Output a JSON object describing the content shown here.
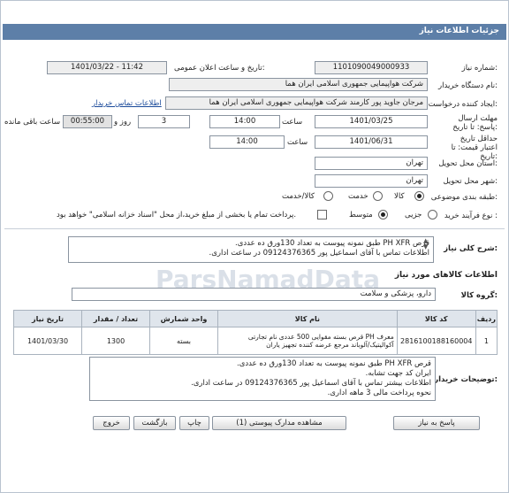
{
  "page_title": "جزئیات اطلاعات نیاز",
  "watermark": "ParsNamadData",
  "fields": {
    "need_number_label": "شماره نیاز:",
    "need_number": "1101090049000933",
    "announce_label": "تاریخ و ساعت اعلان عمومی:",
    "announce_value": "1401/03/22 - 11:42",
    "buyer_label": "نام دستگاه خریدار:",
    "buyer_value": "شرکت هواپیمایی جمهوری اسلامی ایران هما",
    "creator_label": "ایجاد کننده درخواست:",
    "creator_value": "مرجان جاوید پور کارمند شرکت هواپیمایی جمهوری اسلامی ایران هما",
    "contact_link": "اطلاعات تماس خریدار",
    "deadline_label": "مهلت ارسال پاسخ: تا تاریخ:",
    "deadline_date": "1401/03/25",
    "hour_label": "ساعت",
    "deadline_time": "14:00",
    "days": "3",
    "days_label": "روز و",
    "remaining_time": "00:55:00",
    "remaining_label": "ساعت باقی مانده",
    "validity_label": "حداقل تاریخ اعتبار قیمت: تا تاریخ:",
    "validity_date": "1401/06/31",
    "validity_hour_label": "ساعت",
    "validity_time": "14:00",
    "province_label": "استان محل تحویل:",
    "province_value": "تهران",
    "city_label": "شهر محل تحویل:",
    "city_value": "تهران",
    "category_label": "طبقه بندی موضوعی:",
    "category_options": [
      "کالا",
      "خدمت",
      "کالا/خدمت"
    ],
    "process_label": "نوع فرآیند خرید :",
    "process_options": [
      "جزیی",
      "متوسط"
    ],
    "payment_note": "پرداخت تمام یا بخشی از مبلغ خرید،از محل \"اسناد خزانه اسلامی\" خواهد بود."
  },
  "description": {
    "label": "شرح کلی نیاز:",
    "lines": [
      "قرص PH XFR طبق نمونه پیوست به تعداد 130ورق ده عددی.",
      "اطلاعات  تماس با آقای اسماعیل پور 09124376365 در ساعت اداری."
    ]
  },
  "goods_section_title": "اطلاعات کالاهای مورد نیاز",
  "goods_group_label": "گروه کالا:",
  "goods_group_value": "دارو، پزشکی و سلامت",
  "table": {
    "headers": [
      "ردیف",
      "کد کالا",
      "نام کالا",
      "واحد شمارش",
      "تعداد / مقدار",
      "تاریخ نیاز"
    ],
    "rows": [
      {
        "index": "1",
        "code": "2816100188160004",
        "name": "معرف PH قرص بسته مقوایی 500 عددی نام تجارتی آکوالیتیک/آلوباند مرجع عرضه کننده تجهیز یاران",
        "unit": "بسته",
        "qty": "1300",
        "date": "1401/03/30"
      }
    ]
  },
  "buyer_notes": {
    "label": "توضیحات خریدار:",
    "lines": [
      "قرص PH XFR طبق نمونه پیوست به تعداد 130ورق ده عددی.",
      "ایران کد جهت تشابه.",
      "اطلاعات بیشتر تماس با آقای اسماعیل پور 09124376365 در ساعت اداری.",
      "نحوه پرداخت مالی 3 ماهه اداری."
    ]
  },
  "buttons": {
    "reply": "پاسخ به نیاز",
    "attachments": "مشاهده مدارک پیوستی (1)",
    "print": "چاپ",
    "back": "بازگشت",
    "exit": "خروج"
  }
}
